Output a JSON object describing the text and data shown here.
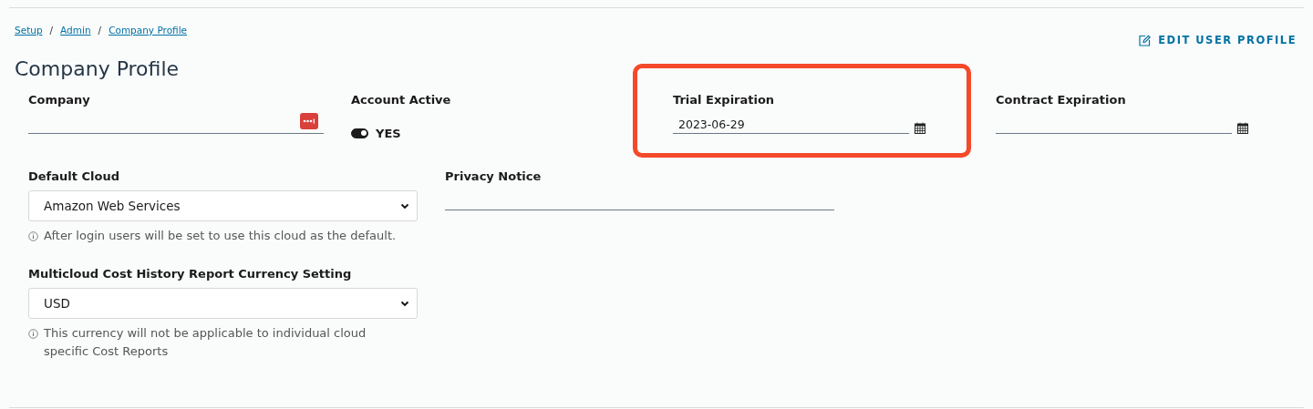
{
  "breadcrumb": [
    {
      "label": "Setup"
    },
    {
      "label": "Admin"
    },
    {
      "label": "Company Profile"
    }
  ],
  "breadcrumb_separator": "/",
  "edit_link": {
    "label": "EDIT USER PROFILE"
  },
  "title": "Company Profile",
  "top_fields": [
    {
      "kind": "text",
      "label": "Company",
      "highlighted": false
    },
    {
      "kind": "toggle",
      "label": "Account Active",
      "on": true,
      "state_label": "YES",
      "highlighted": false
    },
    {
      "kind": "date",
      "label": "Trial Expiration",
      "value": "2023-06-29",
      "highlighted": true
    },
    {
      "kind": "date",
      "label": "Contract Expiration",
      "highlighted": false
    }
  ],
  "default_cloud": {
    "label": "Default Cloud",
    "value": "Amazon Web Services",
    "hint": "After login users will be set to use this cloud as the default."
  },
  "privacy_notice": {
    "label": "Privacy Notice"
  },
  "currency": {
    "label": "Multicloud Cost History Report Currency Setting",
    "value": "USD",
    "hint": "This currency will not be applicable to individual cloud specific Cost Reports"
  }
}
